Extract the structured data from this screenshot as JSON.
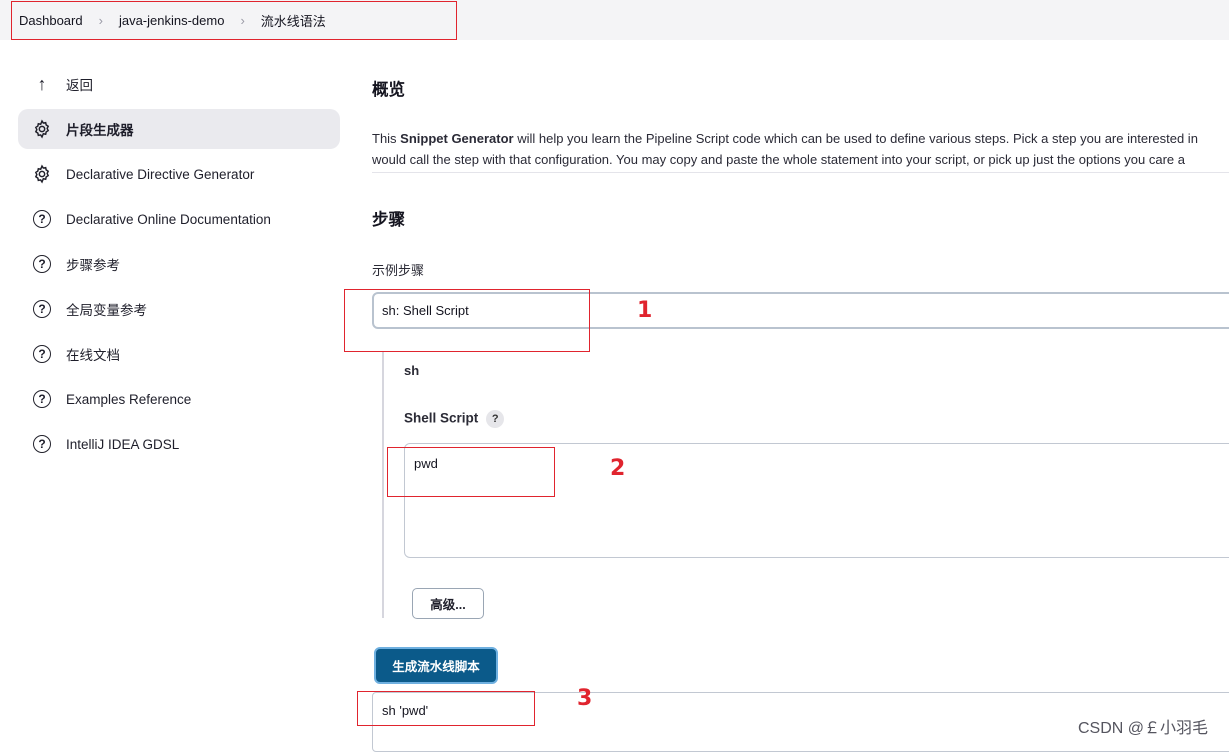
{
  "breadcrumb": {
    "items": [
      "Dashboard",
      "java-jenkins-demo",
      "流水线语法"
    ],
    "separator": "›"
  },
  "sidebar": {
    "items": [
      {
        "label": "返回",
        "icon": "arrow-up-icon"
      },
      {
        "label": "片段生成器",
        "icon": "gear-icon",
        "active": true
      },
      {
        "label": "Declarative Directive Generator",
        "icon": "gear-icon"
      },
      {
        "label": "Declarative Online Documentation",
        "icon": "help-circle-icon"
      },
      {
        "label": "步骤参考",
        "icon": "help-circle-icon"
      },
      {
        "label": "全局变量参考",
        "icon": "help-circle-icon"
      },
      {
        "label": "在线文档",
        "icon": "help-circle-icon"
      },
      {
        "label": "Examples Reference",
        "icon": "help-circle-icon"
      },
      {
        "label": "IntelliJ IDEA GDSL",
        "icon": "help-circle-icon"
      }
    ]
  },
  "main": {
    "overview_title": "概览",
    "description_prefix": "This ",
    "description_bold": "Snippet Generator",
    "description_line1_rest": " will help you learn the Pipeline Script code which can be used to define various steps. Pick a step you are interested in",
    "description_line2": "would call the step with that configuration. You may copy and paste the whole statement into your script, or pick up just the options you care a",
    "steps_title": "步骤",
    "sample_step_label": "示例步骤",
    "sample_step_value": "sh: Shell Script",
    "step_name": "sh",
    "shell_script_label": "Shell Script",
    "help_mark": "?",
    "shell_script_value": "pwd",
    "advanced_button": "高级...",
    "generate_button": "生成流水线脚本",
    "output_value": "sh 'pwd'"
  },
  "annotations": [
    "1",
    "2",
    "3"
  ],
  "watermark": "CSDN @￡小羽毛",
  "colors": {
    "annotation_red": "#e0242e",
    "primary_button": "#0b5a8a",
    "topbar": "#f4f4f6"
  }
}
